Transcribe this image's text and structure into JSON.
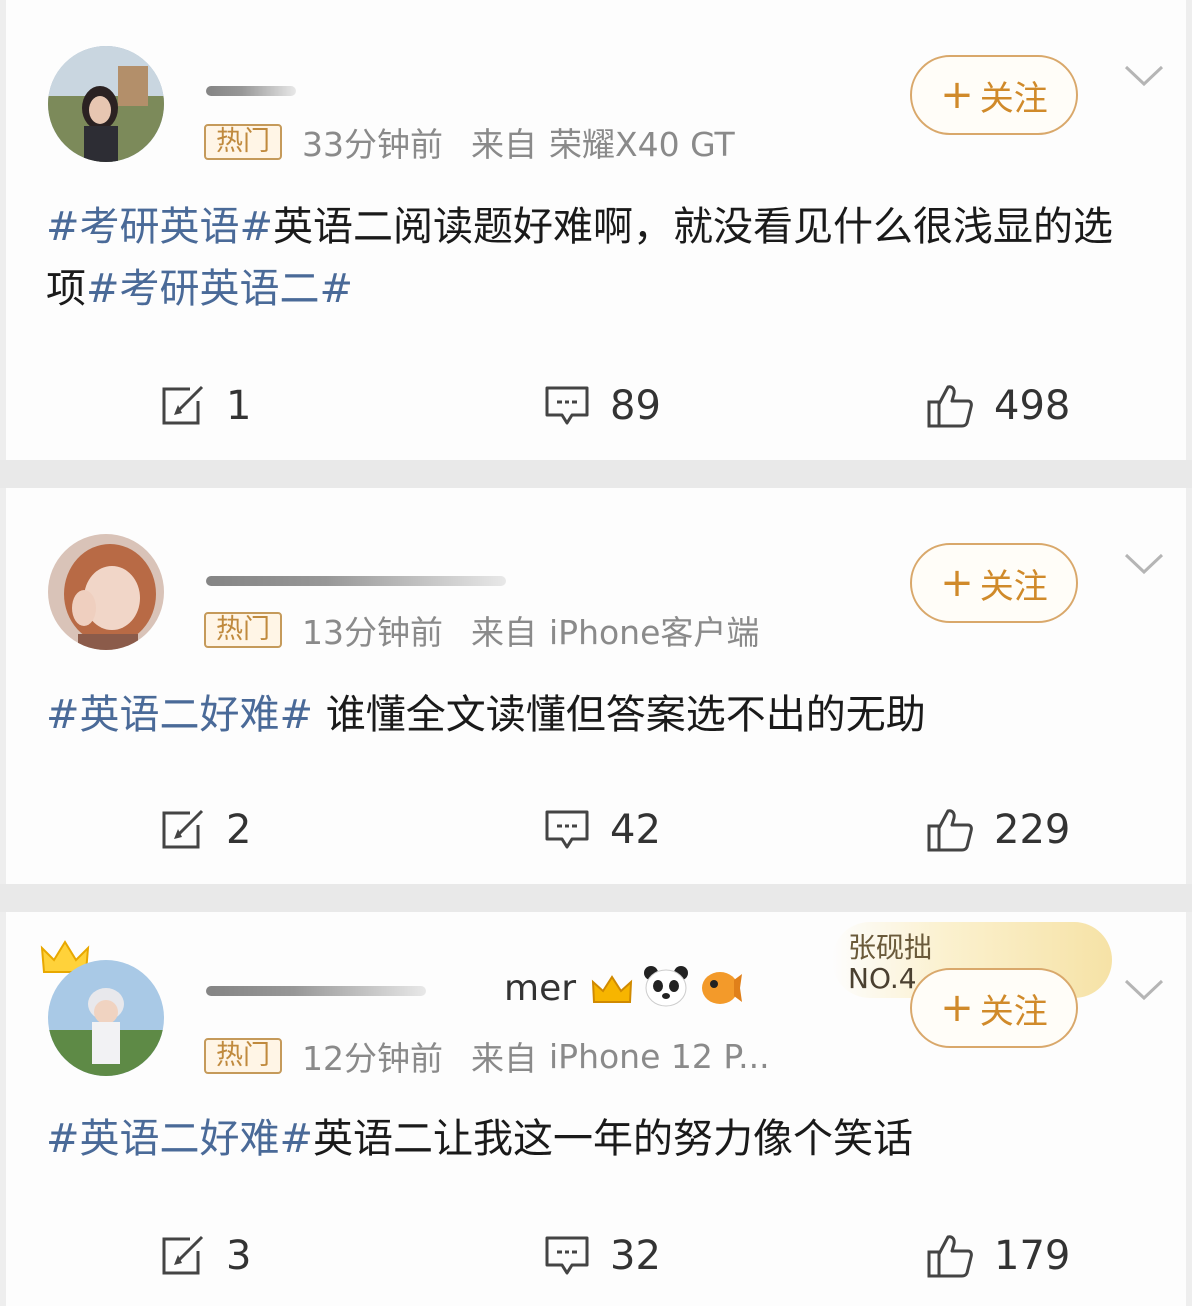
{
  "posts": [
    {
      "hot_label": "热门",
      "time": "33分钟前",
      "source_label": "来自",
      "source": "荣耀X40 GT",
      "follow_label": "关注",
      "text_parts": [
        {
          "t": "#考研英语#",
          "tag": true
        },
        {
          "t": "英语二阅读题好难啊，就没看见什么很浅显的选项",
          "tag": false
        },
        {
          "t": "#考研英语二#",
          "tag": true
        }
      ],
      "reposts": "1",
      "comments": "89",
      "likes": "498"
    },
    {
      "hot_label": "热门",
      "time": "13分钟前",
      "source_label": "来自",
      "source": "iPhone客户端",
      "follow_label": "关注",
      "text_parts": [
        {
          "t": "#英语二好难#",
          "tag": true
        },
        {
          "t": " 谁懂全文读懂但答案选不出的无助",
          "tag": false
        }
      ],
      "reposts": "2",
      "comments": "42",
      "likes": "229"
    },
    {
      "hot_label": "热门",
      "time": "12分钟前",
      "source_label": "来自",
      "source": "iPhone 12 P...",
      "follow_label": "关注",
      "name_visible": "mer",
      "badge_text_1": "张砚拙",
      "badge_text_2": "NO.4",
      "text_parts": [
        {
          "t": "#英语二好难#",
          "tag": true
        },
        {
          "t": "英语二让我这一年的努力像个笑话",
          "tag": false
        }
      ],
      "reposts": "3",
      "comments": "32",
      "likes": "179"
    }
  ],
  "colors": {
    "accent_orange": "#d08a2a",
    "topic_blue": "#4a6a98",
    "meta_gray": "#8a8a8a"
  },
  "icons": [
    "repost-icon",
    "comment-icon",
    "like-icon",
    "chevron-down-icon",
    "plus-icon",
    "crown-icon",
    "panda-icon"
  ]
}
